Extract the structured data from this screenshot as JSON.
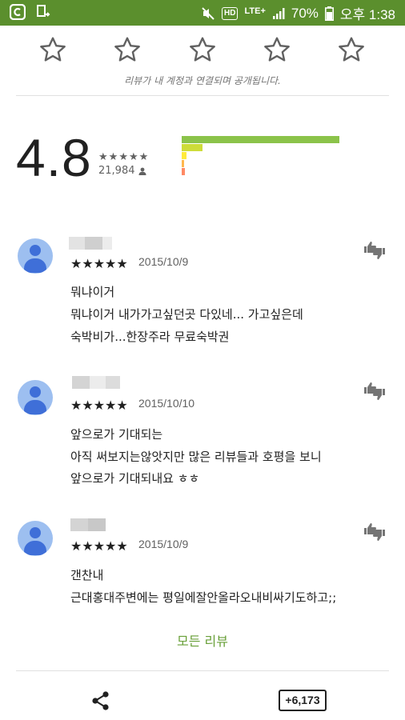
{
  "status_bar": {
    "battery": "70%",
    "time": "오후 1:38",
    "hd_label": "HD",
    "network_label": "LTE+",
    "icons": [
      "app-icon",
      "screen-icon",
      "mute-icon",
      "hd-icon",
      "lte-icon",
      "signal-icon",
      "battery-icon"
    ]
  },
  "rate_prompt": {
    "stars": 5,
    "note": "리뷰가 내 계정과 연결되며 공개됩니다."
  },
  "summary": {
    "score": "4.8",
    "star_rating": 4.8,
    "total_ratings": "21,984",
    "distribution_fraction": [
      1.0,
      0.13,
      0.03,
      0.015,
      0.02
    ],
    "colors": [
      "#8bc34a",
      "#cddc39",
      "#ffeb3b",
      "#ffb74d",
      "#ff8a65"
    ]
  },
  "reviews": [
    {
      "stars": "★★★★★",
      "date": "2015/10/9",
      "title": "뭐냐이거",
      "lines": [
        "뭐냐이거 내가가고싶던곳 다있네... 가고싶은데",
        "숙박비가...한장주라 무료숙박권"
      ]
    },
    {
      "stars": "★★★★★",
      "date": "2015/10/10",
      "title": "앞으로가 기대되는",
      "lines": [
        "아직 써보지는않앗지만 많은 리뷰들과 호평을 보니",
        "앞으로가 기대되내요 ㅎㅎ"
      ]
    },
    {
      "stars": "★★★★★",
      "date": "2015/10/9",
      "title": "갠찬내",
      "lines": [
        "근대홍대주변에는 평일에잘안올라오내비싸기도하고;;"
      ]
    }
  ],
  "all_reviews_label": "모든 리뷰",
  "bottom_bar": {
    "plus_one_label": "+6,173"
  }
}
